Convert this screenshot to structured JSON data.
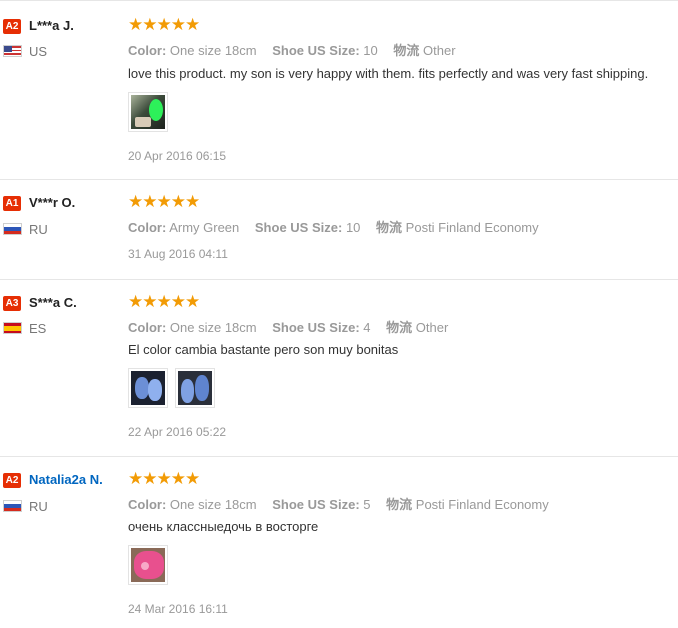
{
  "labels": {
    "color": "Color:",
    "shoe_size": "Shoe US Size:",
    "logistics": "物流"
  },
  "colors": {
    "badge": "#e62e04",
    "star": "#f29b05",
    "link_name": "#0066c0"
  },
  "reviews": [
    {
      "badge": "A2",
      "name": "L***a J.",
      "country": "US",
      "flag": "us-flag",
      "rating": 5,
      "color": "One size 18cm",
      "shoe_size": "10",
      "logistics": "Other",
      "text": "love this product. my son is very happy with them. fits perfectly and was very fast shipping.",
      "photos": [
        "product-photo-green-shoe"
      ],
      "date": "20 Apr 2016 06:15"
    },
    {
      "badge": "A1",
      "name": "V***r O.",
      "country": "RU",
      "flag": "ru-flag",
      "rating": 5,
      "color": "Army Green",
      "shoe_size": "10",
      "logistics": "Posti Finland Economy",
      "text": "",
      "photos": [],
      "date": "31 Aug 2016 04:11"
    },
    {
      "badge": "A3",
      "name": "S***a C.",
      "country": "ES",
      "flag": "es-flag",
      "rating": 5,
      "color": "One size 18cm",
      "shoe_size": "4",
      "logistics": "Other",
      "text": "El color cambia bastante pero son muy bonitas",
      "photos": [
        "product-photo-blue-slippers-1",
        "product-photo-blue-slippers-2"
      ],
      "date": "22 Apr 2016 05:22"
    },
    {
      "badge": "A2",
      "name": "Natalia2a N.",
      "country": "RU",
      "flag": "ru-flag",
      "rating": 5,
      "color": "One size 18cm",
      "shoe_size": "5",
      "logistics": "Posti Finland Economy",
      "text": "очень классныедочь в восторге",
      "photos": [
        "product-photo-pink-slippers"
      ],
      "date": "24 Mar 2016 16:11"
    }
  ]
}
